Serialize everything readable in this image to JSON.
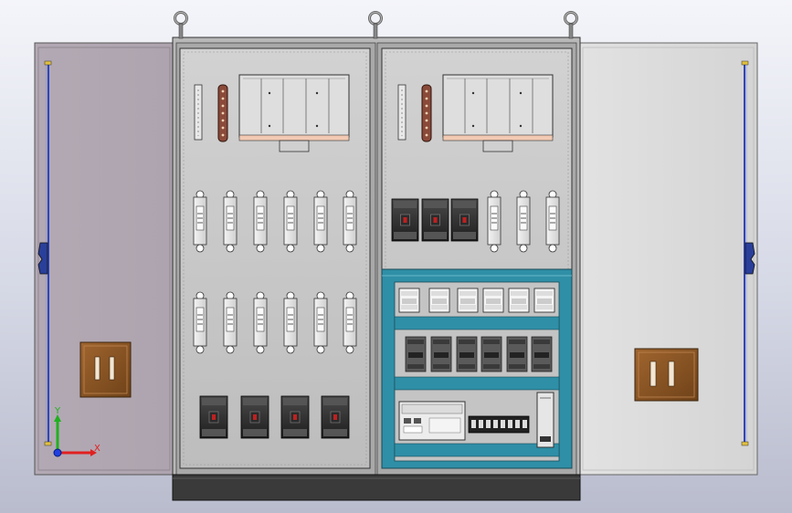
{
  "view": {
    "colors": {
      "background_top": "#f4f5fa",
      "background_bottom": "#b9bccd",
      "left_door": "#b6adb6",
      "right_door": "#dcdcdc",
      "cabinet_body": "#c8c8c8",
      "plinth": "#3a3a3a",
      "din_frame": "#2f8fa6",
      "door_handle": "#8a5526",
      "hinge_rod": "#2f45b8",
      "busbar": "#8a4a3a"
    }
  },
  "triad": {
    "x_label": "X",
    "y_label": "Y",
    "x_color": "#e02020",
    "y_color": "#20b020",
    "z_color": "#2040e0"
  },
  "icons": {
    "lifting_eye": "lifting-eye-icon",
    "handle": "door-handle-icon",
    "breaker": "circuit-breaker-icon",
    "fuse": "fuse-holder-icon",
    "relay": "relay-icon",
    "plc": "plc-icon",
    "terminal": "terminal-block-icon"
  }
}
